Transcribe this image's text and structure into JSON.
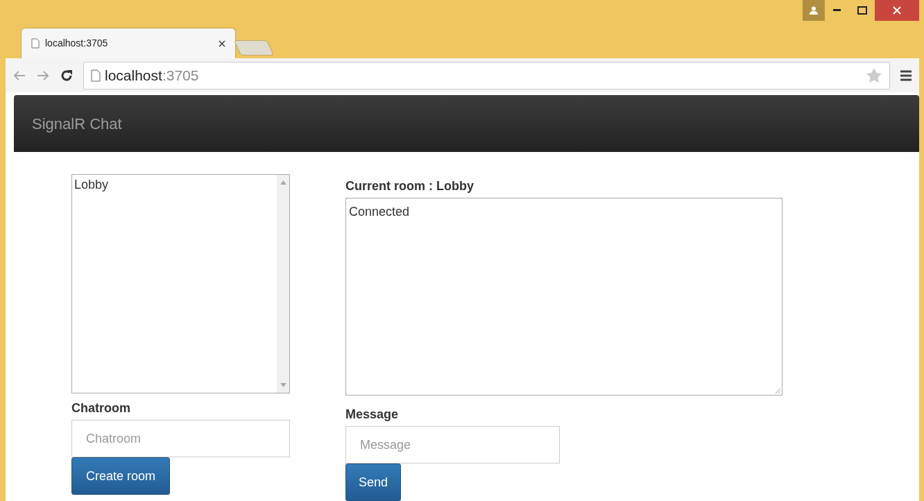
{
  "browser": {
    "tabs": [
      {
        "title": "localhost:3705",
        "selected": true
      }
    ],
    "address": {
      "host": "localhost",
      "port": ":3705"
    }
  },
  "navbar": {
    "brand": "SignalR Chat"
  },
  "rooms": {
    "items": [
      {
        "name": "Lobby",
        "selected": false
      }
    ],
    "label": "Chatroom",
    "placeholder": "Chatroom",
    "button": "Create room"
  },
  "chat": {
    "current_room": "Current room : Lobby",
    "messages": [
      "Connected"
    ],
    "label": "Message",
    "placeholder": "Message",
    "button": "Send"
  }
}
